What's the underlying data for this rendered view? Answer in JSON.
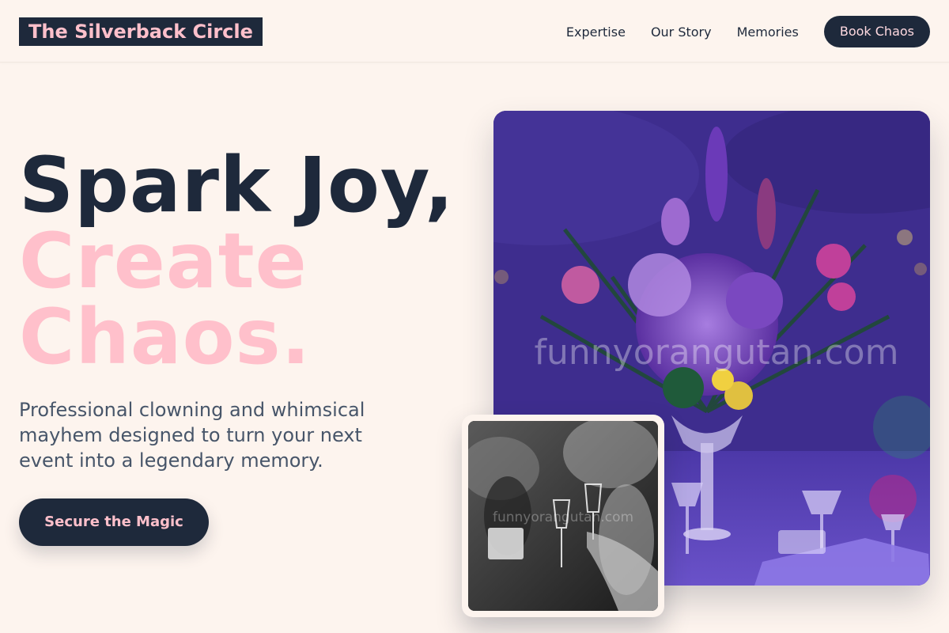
{
  "brand": {
    "name": "The Silverback Circle"
  },
  "nav": {
    "links": [
      "Expertise",
      "Our Story",
      "Memories"
    ],
    "cta_label": "Book Chaos"
  },
  "hero": {
    "headline_line1": "Spark Joy,",
    "headline_line2": "Create",
    "headline_line3": "Chaos.",
    "subtext": "Professional clowning and whimsical mayhem designed to turn your next event into a legendary memory.",
    "cta_label": "Secure the Magic"
  },
  "images": {
    "main": {
      "watermark": "funnyorangutan.com",
      "alt_subject": "purple floral centerpiece with wine glasses"
    },
    "inset": {
      "watermark": "funnyorangutan.com",
      "alt_subject": "black and white toast with champagne glasses"
    }
  },
  "colors": {
    "background": "#fdf4ee",
    "navy": "#1e293b",
    "pink": "#ffc0cb",
    "body_text": "#475569"
  }
}
